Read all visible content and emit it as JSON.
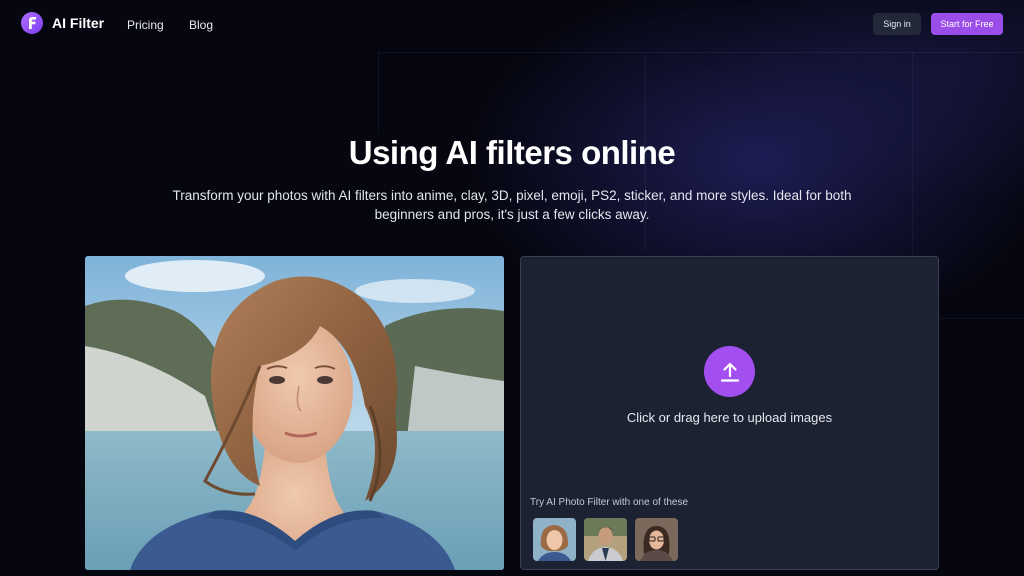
{
  "header": {
    "logo_text": "AI Filter",
    "logo_icon": "letter-f-logo-icon",
    "nav": [
      "Pricing",
      "Blog"
    ],
    "sign_in": "Sign in",
    "start_free": "Start for Free"
  },
  "hero": {
    "title": "Using AI filters online",
    "subtitle": "Transform your photos with AI filters into anime, clay, 3D, pixel, emoji, PS2, sticker, and more styles. Ideal for both beginners and pros, it's just a few clicks away."
  },
  "upload": {
    "icon": "upload-arrow-icon",
    "label": "Click or drag here to upload images",
    "try_label": "Try AI Photo Filter with one of these"
  },
  "colors": {
    "accent": "#9b4dea",
    "upload_button": "#a34ff0",
    "background": "#05060f",
    "panel": "#1c2231"
  }
}
